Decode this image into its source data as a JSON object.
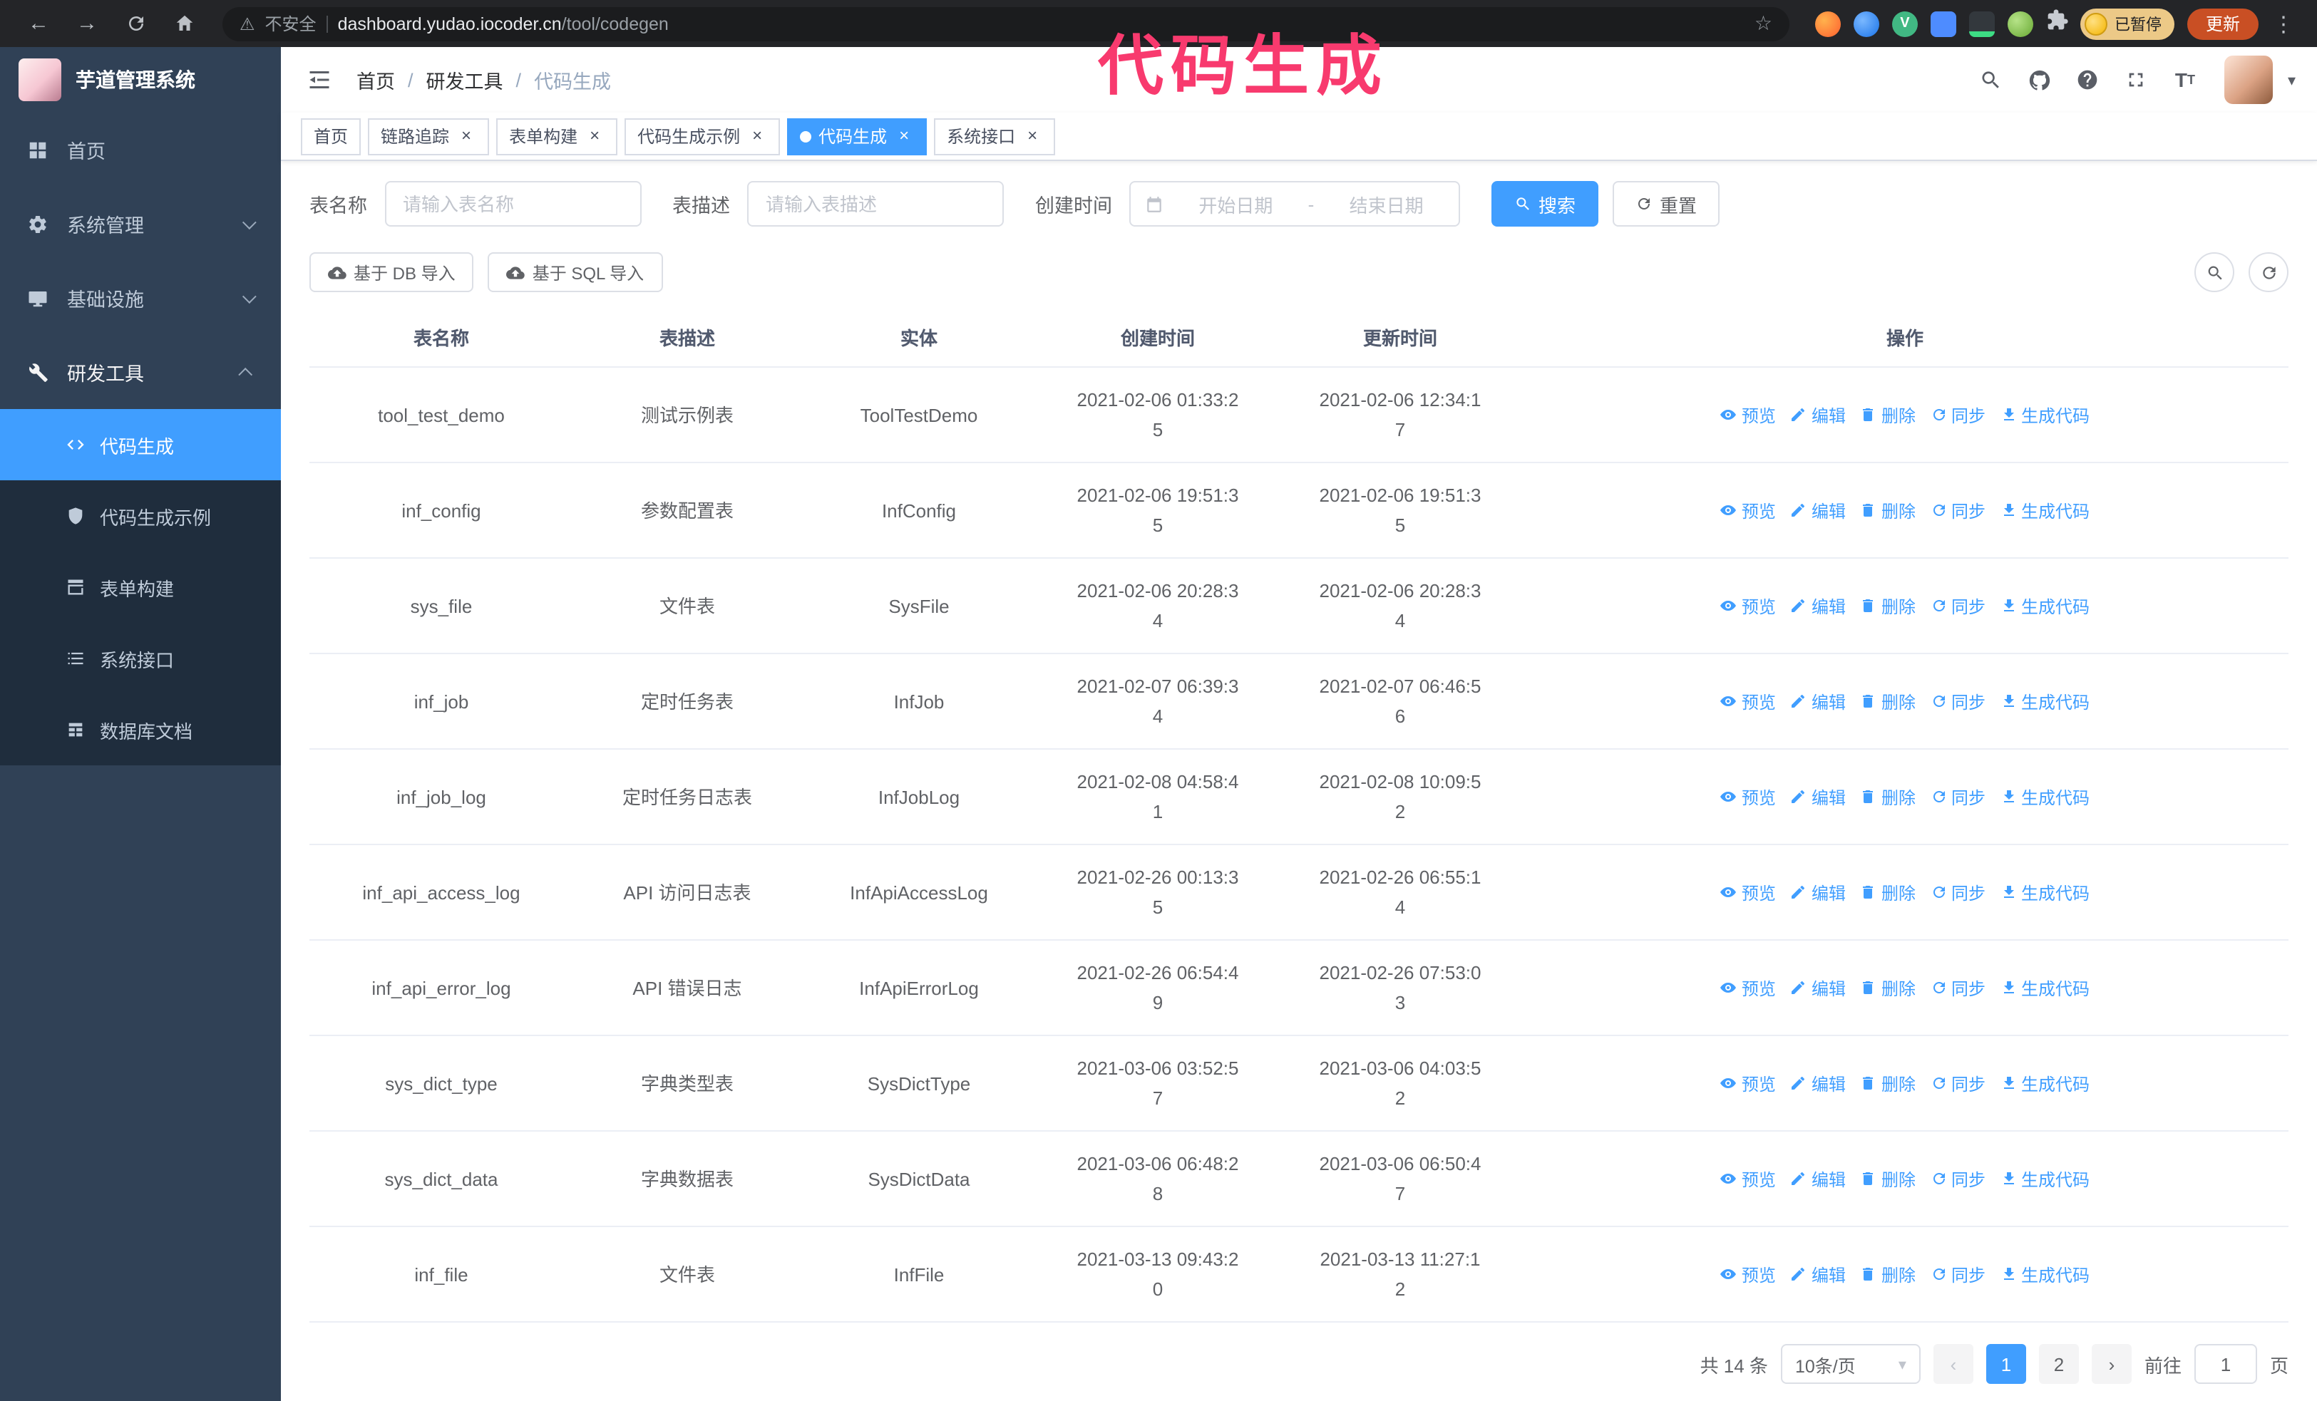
{
  "colors": {
    "accent": "#409eff",
    "sidebar_bg": "#304156",
    "submenu_bg": "#1f2d3d",
    "annotation": "#f83a6e"
  },
  "icons": {
    "back": "←",
    "forward": "→",
    "star": "☆",
    "warning": "⚠",
    "more": "⋮",
    "caret_down": "▾",
    "close": "×",
    "prev": "‹",
    "next": "›",
    "vue_badge": "V"
  },
  "browser": {
    "security_warning": "不安全",
    "url_host": "dashboard.yudao.iocoder.cn",
    "url_path": "/tool/codegen",
    "paused_badge": "已暂停",
    "update_button": "更新"
  },
  "annotation": {
    "text": "代码生成"
  },
  "sidebar": {
    "logo_title": "芋道管理系统",
    "menu": [
      {
        "label": "首页"
      },
      {
        "label": "系统管理"
      },
      {
        "label": "基础设施"
      },
      {
        "label": "研发工具"
      }
    ],
    "submenu": [
      {
        "label": "代码生成"
      },
      {
        "label": "代码生成示例"
      },
      {
        "label": "表单构建"
      },
      {
        "label": "系统接口"
      },
      {
        "label": "数据库文档"
      }
    ]
  },
  "header": {
    "breadcrumb": [
      "首页",
      "研发工具",
      "代码生成"
    ],
    "separator": "/"
  },
  "tabs": [
    {
      "label": "首页"
    },
    {
      "label": "链路追踪"
    },
    {
      "label": "表单构建"
    },
    {
      "label": "代码生成示例"
    },
    {
      "label": "代码生成"
    },
    {
      "label": "系统接口"
    }
  ],
  "filters": {
    "table_name_label": "表名称",
    "table_name_placeholder": "请输入表名称",
    "table_desc_label": "表描述",
    "table_desc_placeholder": "请输入表描述",
    "create_time_label": "创建时间",
    "date_start_placeholder": "开始日期",
    "date_separator": "-",
    "date_end_placeholder": "结束日期",
    "search_button": "搜索",
    "reset_button": "重置"
  },
  "toolbar": {
    "import_db_button": "基于 DB 导入",
    "import_sql_button": "基于 SQL 导入"
  },
  "table": {
    "columns": [
      "表名称",
      "表描述",
      "实体",
      "创建时间",
      "更新时间",
      "操作"
    ],
    "row_actions": [
      "预览",
      "编辑",
      "删除",
      "同步",
      "生成代码"
    ],
    "rows": [
      {
        "name": "tool_test_demo",
        "desc": "测试示例表",
        "entity": "ToolTestDemo",
        "created": "2021-02-06 01:33:25",
        "updated": "2021-02-06 12:34:17"
      },
      {
        "name": "inf_config",
        "desc": "参数配置表",
        "entity": "InfConfig",
        "created": "2021-02-06 19:51:35",
        "updated": "2021-02-06 19:51:35"
      },
      {
        "name": "sys_file",
        "desc": "文件表",
        "entity": "SysFile",
        "created": "2021-02-06 20:28:34",
        "updated": "2021-02-06 20:28:34"
      },
      {
        "name": "inf_job",
        "desc": "定时任务表",
        "entity": "InfJob",
        "created": "2021-02-07 06:39:34",
        "updated": "2021-02-07 06:46:56"
      },
      {
        "name": "inf_job_log",
        "desc": "定时任务日志表",
        "entity": "InfJobLog",
        "created": "2021-02-08 04:58:41",
        "updated": "2021-02-08 10:09:52"
      },
      {
        "name": "inf_api_access_log",
        "desc": "API 访问日志表",
        "entity": "InfApiAccessLog",
        "created": "2021-02-26 00:13:35",
        "updated": "2021-02-26 06:55:14"
      },
      {
        "name": "inf_api_error_log",
        "desc": "API 错误日志",
        "entity": "InfApiErrorLog",
        "created": "2021-02-26 06:54:49",
        "updated": "2021-02-26 07:53:03"
      },
      {
        "name": "sys_dict_type",
        "desc": "字典类型表",
        "entity": "SysDictType",
        "created": "2021-03-06 03:52:57",
        "updated": "2021-03-06 04:03:52"
      },
      {
        "name": "sys_dict_data",
        "desc": "字典数据表",
        "entity": "SysDictData",
        "created": "2021-03-06 06:48:28",
        "updated": "2021-03-06 06:50:47"
      },
      {
        "name": "inf_file",
        "desc": "文件表",
        "entity": "InfFile",
        "created": "2021-03-13 09:43:20",
        "updated": "2021-03-13 11:27:12"
      }
    ]
  },
  "pagination": {
    "total": "共 14 条",
    "page_size": "10条/页",
    "pages": [
      "1",
      "2"
    ],
    "goto_label": "前往",
    "goto_value": "1",
    "goto_unit": "页"
  }
}
